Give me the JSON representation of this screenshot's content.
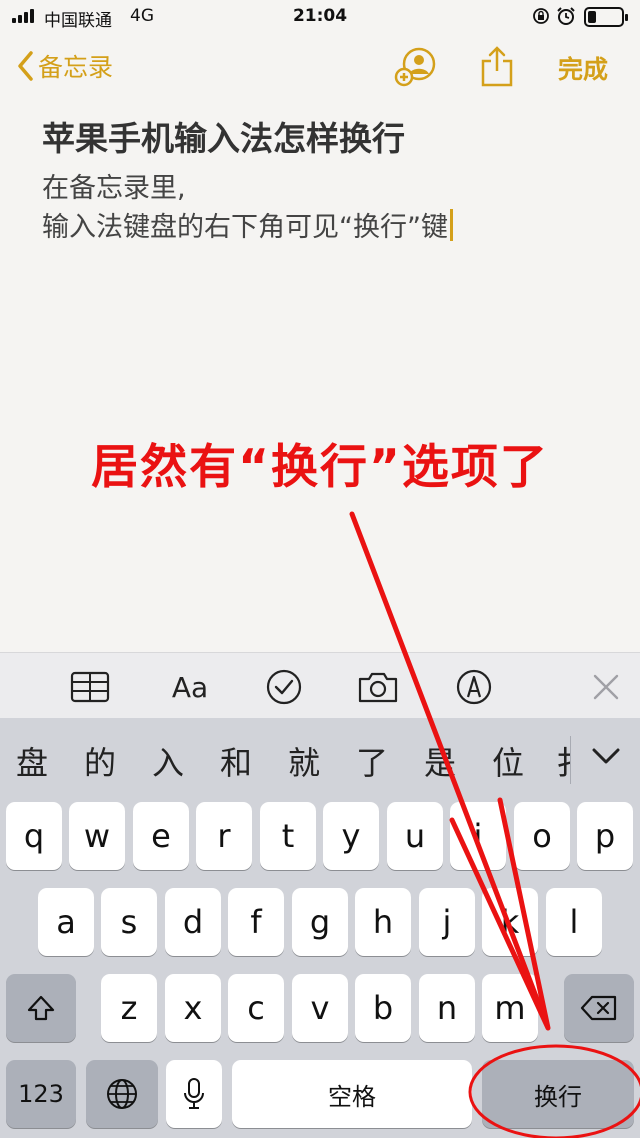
{
  "status_bar": {
    "carrier": "中国联通",
    "network": "4G",
    "time": "21:04",
    "icons": [
      "rotation-lock-icon",
      "alarm-icon",
      "battery-icon"
    ],
    "battery_level": 0.25
  },
  "nav": {
    "back_label": "备忘录",
    "done_label": "完成",
    "accent_color": "#d4a01a"
  },
  "note": {
    "title": "苹果手机输入法怎样换行",
    "line1": "在备忘录里,",
    "line2": "输入法键盘的右下角可见“换行”键"
  },
  "annotation": {
    "text": "居然有“换行”选项了",
    "color": "#ea1212"
  },
  "format_toolbar": {
    "aa_label": "Aa",
    "icons": [
      "table-icon",
      "text-format-icon",
      "checklist-icon",
      "camera-icon",
      "markup-pen-icon",
      "close-icon"
    ]
  },
  "candidates": [
    "盘",
    "的",
    "入",
    "和",
    "就",
    "了",
    "是",
    "位",
    "扌"
  ],
  "keyboard": {
    "row1": [
      "q",
      "w",
      "e",
      "r",
      "t",
      "y",
      "u",
      "i",
      "o",
      "p"
    ],
    "row2": [
      "a",
      "s",
      "d",
      "f",
      "g",
      "h",
      "j",
      "k",
      "l"
    ],
    "row3": [
      "z",
      "x",
      "c",
      "v",
      "b",
      "n",
      "m"
    ],
    "numbers_label": "123",
    "space_label": "空格",
    "return_label": "换行"
  }
}
